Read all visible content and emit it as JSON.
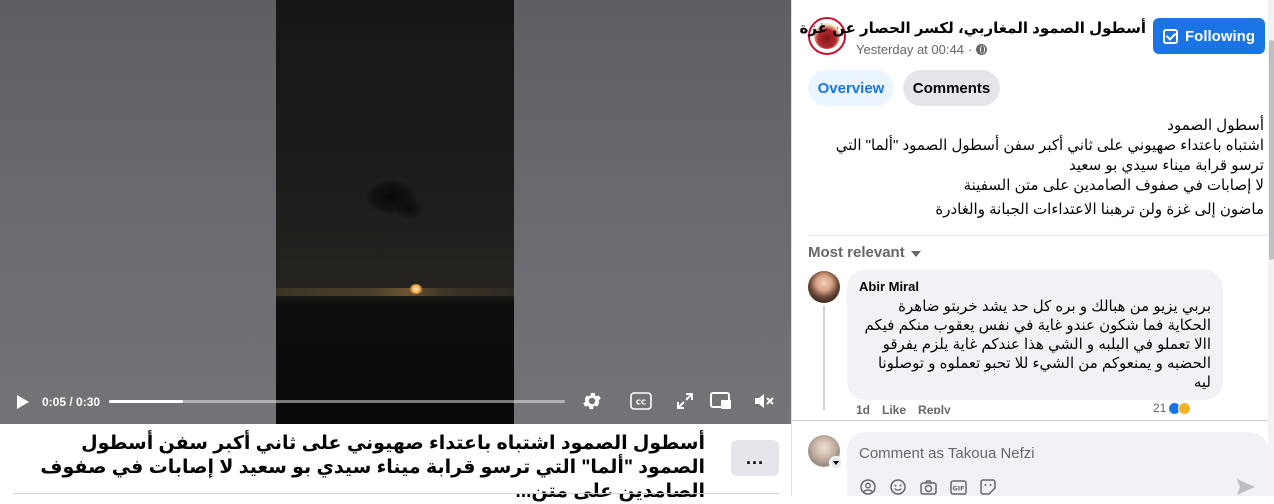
{
  "video": {
    "current_time": "0:05",
    "duration": "0:30",
    "time_separator": " / ",
    "progress_fraction": 0.163,
    "buffered_fraction": 0.94
  },
  "caption": {
    "text": "أسطول الصمود اشتباه باعتداء صهيوني على ثاني أكبر سفن أسطول الصمود \"ألما\" التي ترسو قرابة ميناء سيدي بو سعيد لا إصابات في صفوف الصامدين على متن...",
    "more_label": "..."
  },
  "page": {
    "name": "أسطول الصمود المغاربي، لكسر الحصار عن غزة",
    "time": "Yesterday at 00:44",
    "time_separator": " · ",
    "follow_label": "Following"
  },
  "tabs": {
    "overview": "Overview",
    "comments": "Comments"
  },
  "post": {
    "lines": [
      "أسطول الصمود",
      "اشتباه باعتداء صهيوني على ثاني أكبر سفن أسطول الصمود \"ألما\" التي ترسو قرابة ميناء سيدي بو سعيد",
      "لا إصابات في صفوف الصامدين على متن السفينة",
      "ماضون إلى غزة ولن ترهبنا الاعتداءات الجبانة والغادرة"
    ]
  },
  "comments": {
    "sort_label": "Most relevant",
    "items": [
      {
        "author": "Abir Miral",
        "text": "بربي يزيو من هبالك و بره كل حد يشد خربتو ضاهرة الحكاية فما شكون عندو غاية في نفس يعقوب منكم فيكم االا تعملو في البلبه و الشي هذا عندكم غاية يلزم يفرقو الحضبه و يمنعوكم من الشيء للا تحبو تعملوه و توصلونا ليه",
        "age": "1d",
        "like_label": "Like",
        "reply_label": "Reply",
        "reactions": "21"
      }
    ]
  },
  "composer": {
    "placeholder": "Comment as Takoua Nefzi",
    "tools": [
      "GIF"
    ]
  }
}
